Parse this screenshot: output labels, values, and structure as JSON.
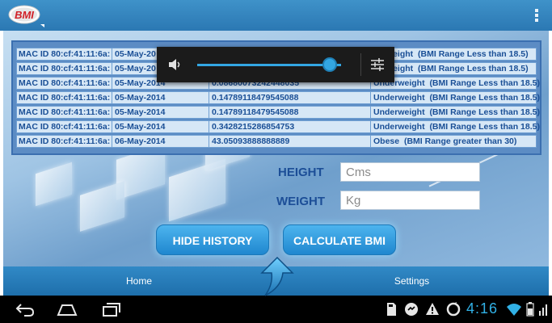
{
  "app": {
    "logo_text": "BMI"
  },
  "history": {
    "rows": [
      {
        "mac": "MAC ID 80:cf:41:11:6a:",
        "date": "05-May-20",
        "value": "",
        "category": "erweight",
        "range": "(BMI Range Less than  18.5)"
      },
      {
        "mac": "MAC ID 80:cf:41:11:6a:",
        "date": "05-May-20",
        "value": "",
        "category": "erweight",
        "range": "(BMI Range Less than  18.5)"
      },
      {
        "mac": "MAC ID 80:cf:41:11:6a:",
        "date": "05-May-2014",
        "value": "0.08680073242448035",
        "category": "Underweight",
        "range": "(BMI Range Less than  18.5)"
      },
      {
        "mac": "MAC ID 80:cf:41:11:6a:",
        "date": "05-May-2014",
        "value": "0.14789118479545088",
        "category": "Underweight",
        "range": "(BMI Range Less than  18.5)"
      },
      {
        "mac": "MAC ID 80:cf:41:11:6a:",
        "date": "05-May-2014",
        "value": "0.14789118479545088",
        "category": "Underweight",
        "range": "(BMI Range Less than  18.5)"
      },
      {
        "mac": "MAC ID 80:cf:41:11:6a:",
        "date": "05-May-2014",
        "value": "0.3428215286854753",
        "category": "Underweight",
        "range": "(BMI Range Less than  18.5)"
      },
      {
        "mac": "MAC ID 80:cf:41:11:6a:",
        "date": "06-May-2014",
        "value": "43.05093888888889",
        "category": "Obese",
        "range": "(BMI Range greater than 30)"
      }
    ]
  },
  "volume": {
    "level": 0.92,
    "accent": "#33a7e3"
  },
  "form": {
    "height_label": "HEIGHT",
    "height_placeholder": "Cms",
    "weight_label": "WEIGHT",
    "weight_placeholder": "Kg"
  },
  "buttons": {
    "hide_history": "HIDE HISTORY",
    "calculate": "CALCULATE BMI"
  },
  "tabs": {
    "home": "Home",
    "settings": "Settings"
  },
  "status": {
    "time": "4:16"
  },
  "colors": {
    "bar": "#2b78b3",
    "text_blue": "#1c4e97",
    "button": "#1f87cf"
  }
}
